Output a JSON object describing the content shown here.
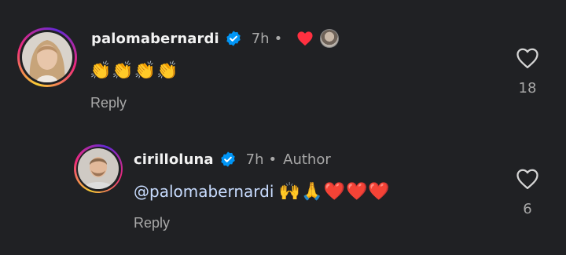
{
  "comments": [
    {
      "username": "palomabernardi",
      "time": "7h",
      "body": "👏👏👏👏",
      "reply_label": "Reply",
      "like_count": "18"
    },
    {
      "username": "cirilloluna",
      "time": "7h",
      "author_label": "Author",
      "mention": "@palomabernardi",
      "body_emojis": "🙌🙏❤️❤️❤️",
      "reply_label": "Reply",
      "like_count": "6"
    }
  ],
  "icons": {
    "verified": "verified-badge-icon",
    "like": "heart-outline-icon",
    "liked_by_author": "red-heart-icon"
  },
  "colors": {
    "background": "#202124",
    "verified_blue": "#0095f6",
    "heart_red": "#ff3040",
    "muted": "#a8a8a8"
  }
}
